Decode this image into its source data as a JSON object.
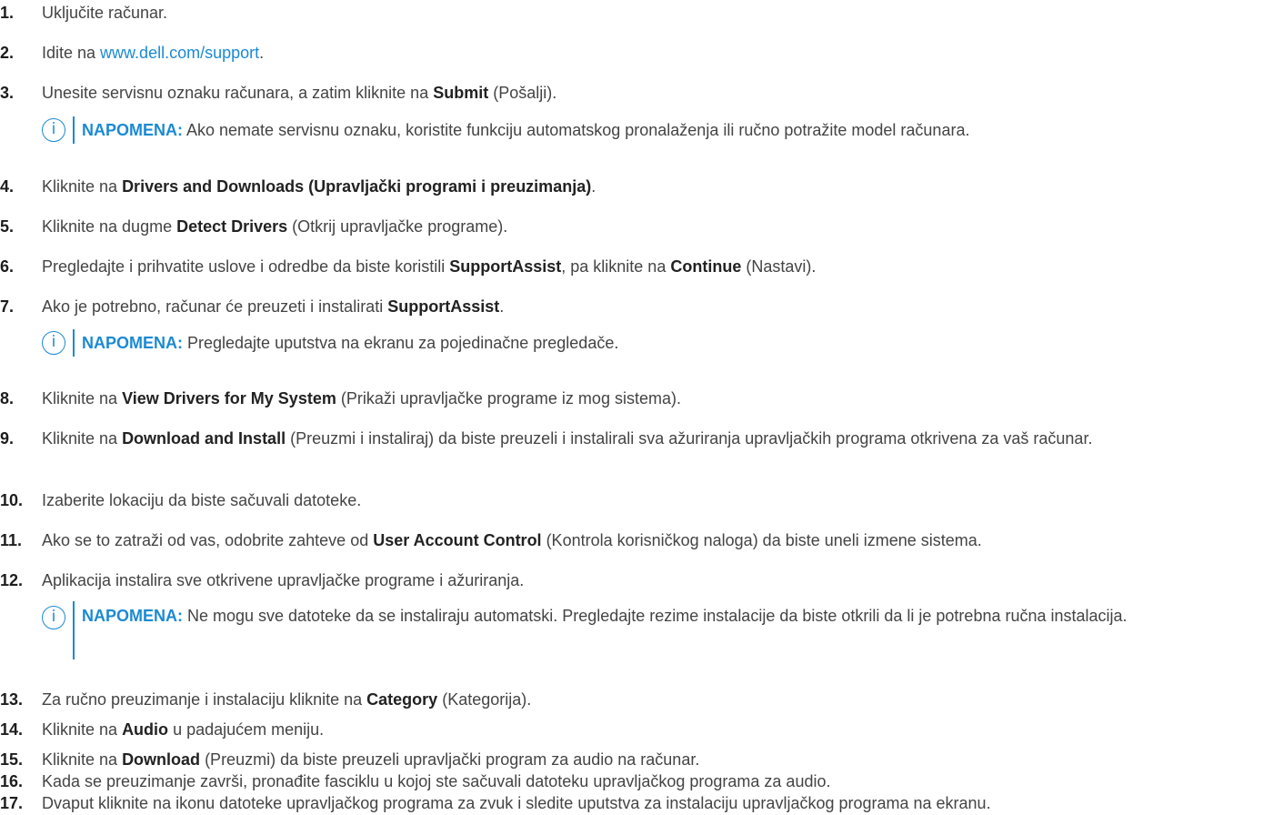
{
  "steps": [
    {
      "num": "1.",
      "text": "Uključite računar."
    },
    {
      "num": "2.",
      "pre": "Idite na ",
      "link": "www.dell.com/support",
      "post": "."
    },
    {
      "num": "3.",
      "pre": "Unesite servisnu oznaku računara, a zatim kliknite na ",
      "b1": "Submit",
      "post": " (Pošalji)."
    },
    {
      "num": "4.",
      "pre": "Kliknite na ",
      "b1": "Drivers and Downloads (Upravljački programi i preuzimanja)",
      "post": "."
    },
    {
      "num": "5.",
      "pre": "Kliknite na dugme ",
      "b1": "Detect Drivers",
      "post": " (Otkrij upravljačke programe)."
    },
    {
      "num": "6.",
      "pre": "Pregledajte i prihvatite uslove i odredbe da biste koristili ",
      "b1": "SupportAssist",
      "mid": ", pa kliknite na ",
      "b2": "Continue",
      "post": " (Nastavi)."
    },
    {
      "num": "7.",
      "pre": "Ako je potrebno, računar će preuzeti i instalirati ",
      "b1": "SupportAssist",
      "post": "."
    },
    {
      "num": "8.",
      "pre": "Kliknite na ",
      "b1": "View Drivers for My System",
      "post": " (Prikaži upravljačke programe iz mog sistema)."
    },
    {
      "num": "9.",
      "pre": "Kliknite na ",
      "b1": "Download and Install",
      "post": " (Preuzmi i instaliraj) da biste preuzeli i instalirali sva ažuriranja upravljačkih programa otkrivena za vaš računar."
    },
    {
      "num": "10.",
      "text": "Izaberite lokaciju da biste sačuvali datoteke."
    },
    {
      "num": "11.",
      "pre": "Ako se to zatraži od vas, odobrite zahteve od ",
      "b1": "User Account Control",
      "post": " (Kontrola korisničkog naloga) da biste uneli izmene sistema."
    },
    {
      "num": "12.",
      "text": "Aplikacija instalira sve otkrivene upravljačke programe i ažuriranja."
    },
    {
      "num": "13.",
      "pre": "Za ručno preuzimanje i instalaciju kliknite na ",
      "b1": "Category",
      "post": " (Kategorija)."
    },
    {
      "num": "14.",
      "pre": "Kliknite na ",
      "b1": "Audio",
      "post": " u padajućem meniju."
    },
    {
      "num": "15.",
      "pre": "Kliknite na ",
      "b1": "Download",
      "post": " (Preuzmi) da biste preuzeli upravljački program za audio na računar."
    },
    {
      "num": "16.",
      "text": "Kada se preuzimanje završi, pronađite fasciklu u kojoj ste sačuvali datoteku upravljačkog programa za audio."
    },
    {
      "num": "17.",
      "text": "Dvaput kliknite na ikonu datoteke upravljačkog programa za zvuk i sledite uputstva za instalaciju upravljačkog programa na ekranu."
    }
  ],
  "notes": [
    {
      "label": "NAPOMENA:",
      "text": " Ako nemate servisnu oznaku, koristite funkciju automatskog pronalaženja ili ručno potražite model računara."
    },
    {
      "label": "NAPOMENA:",
      "text": " Pregledajte uputstva na ekranu za pojedinačne pregledače."
    },
    {
      "label": "NAPOMENA:",
      "text": " Ne mogu sve datoteke da se instaliraju automatski. Pregledajte rezime instalacije da biste otkrili da li je potrebna ručna instalacija."
    }
  ],
  "note_icon_glyph": "i",
  "colors": {
    "accent": "#1b8ad3",
    "text": "#444444"
  }
}
